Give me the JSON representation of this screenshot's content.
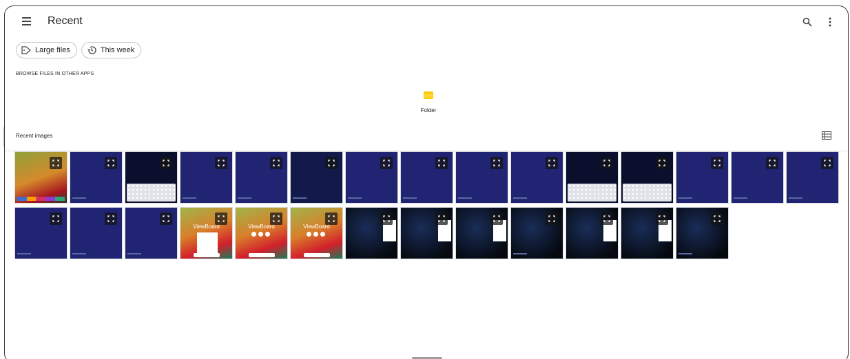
{
  "app": {
    "title": "Recent"
  },
  "toolbar": {
    "menu_icon": "hamburger-menu-icon",
    "search_icon": "search-icon",
    "more_icon": "more-vert-icon"
  },
  "chips": [
    {
      "label": "Large files",
      "icon": "label-tag-icon"
    },
    {
      "label": "This week",
      "icon": "history-icon"
    }
  ],
  "browse": {
    "heading": "BROWSE FILES IN OTHER APPS",
    "apps": [
      {
        "label": "Folder",
        "icon": "folder-icon",
        "color": "#f9c900"
      }
    ]
  },
  "recent_images": {
    "heading": "Recent images",
    "view_toggle_icon": "list-view-icon",
    "thumbnails": [
      {
        "style": "bands",
        "kind": "taskbar"
      },
      {
        "style": "blue",
        "kind": "plain"
      },
      {
        "style": "darknav",
        "kind": "keyboard"
      },
      {
        "style": "blue",
        "kind": "plain"
      },
      {
        "style": "blue",
        "kind": "plain"
      },
      {
        "style": "navy",
        "kind": "plain"
      },
      {
        "style": "blue",
        "kind": "plain"
      },
      {
        "style": "blue",
        "kind": "plain"
      },
      {
        "style": "blue",
        "kind": "plain"
      },
      {
        "style": "blue",
        "kind": "plain"
      },
      {
        "style": "darknav",
        "kind": "keyboard"
      },
      {
        "style": "darknav",
        "kind": "keyboard"
      },
      {
        "style": "blue",
        "kind": "plain"
      },
      {
        "style": "blue",
        "kind": "plain"
      },
      {
        "style": "blue",
        "kind": "plain"
      },
      {
        "style": "blue",
        "kind": "plain"
      },
      {
        "style": "blue",
        "kind": "plain"
      },
      {
        "style": "blue",
        "kind": "plain"
      },
      {
        "style": "gradient",
        "kind": "viewboard-panel",
        "text": "ViewBoard"
      },
      {
        "style": "gradient",
        "kind": "viewboard",
        "text": "ViewBoard"
      },
      {
        "style": "gradient",
        "kind": "viewboard",
        "text": "ViewBoard"
      },
      {
        "style": "spider",
        "kind": "dialog"
      },
      {
        "style": "spider",
        "kind": "dialog"
      },
      {
        "style": "spider",
        "kind": "dialog"
      },
      {
        "style": "spider",
        "kind": "plain"
      },
      {
        "style": "spider",
        "kind": "dialog"
      },
      {
        "style": "spider",
        "kind": "dialog"
      },
      {
        "style": "spider",
        "kind": "plain"
      }
    ]
  },
  "colors": {
    "accent_folder": "#f9c900",
    "thumbnail_blue": "#202472",
    "border": "#dadce0"
  }
}
